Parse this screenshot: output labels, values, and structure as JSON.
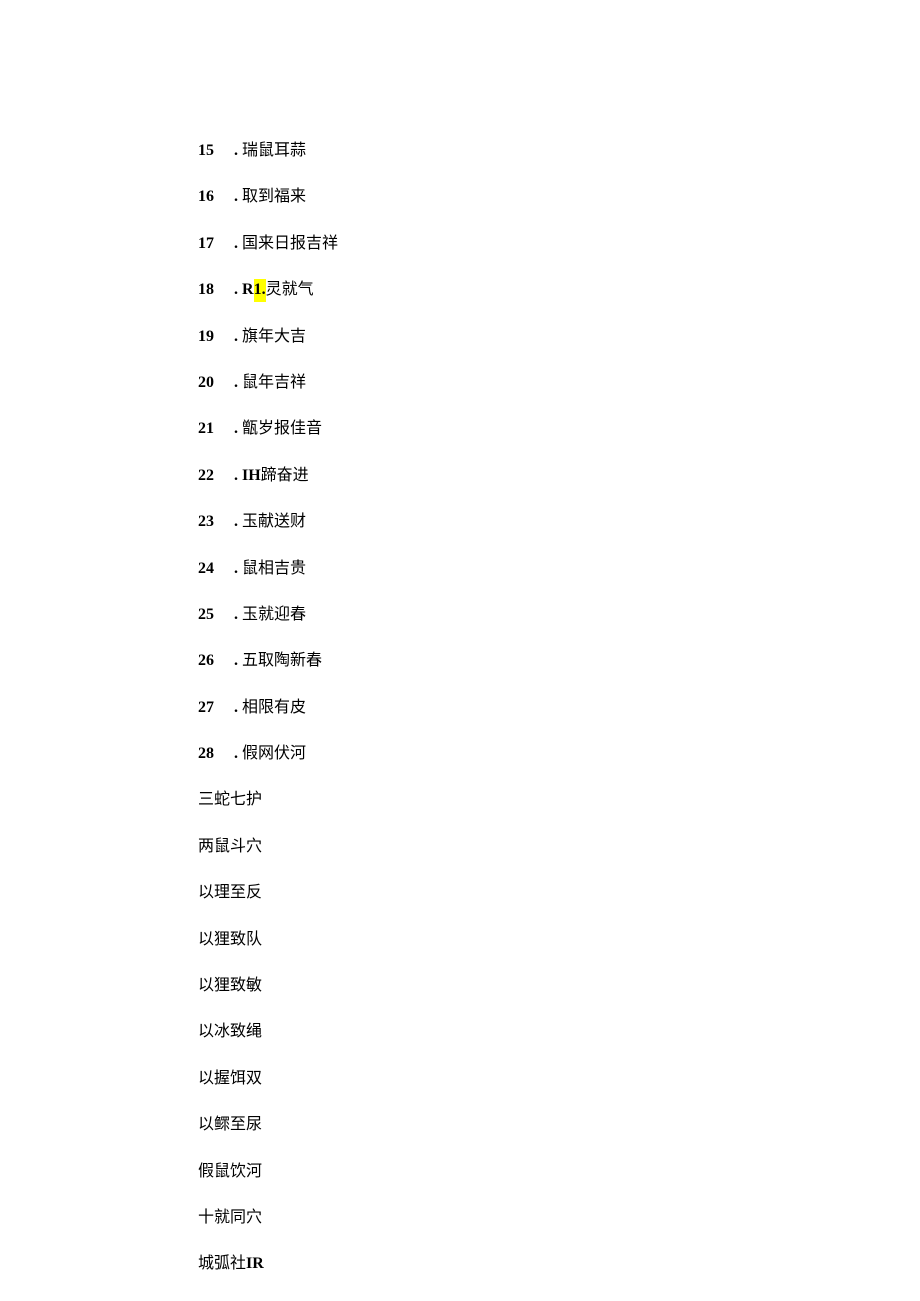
{
  "numbered_items": [
    {
      "num": "15",
      "sep": ".",
      "wide": true,
      "prefix": "",
      "highlight": "",
      "text": "瑞鼠耳蒜"
    },
    {
      "num": "16",
      "sep": ". ",
      "wide": true,
      "prefix": "",
      "highlight": "",
      "text": "取到福来"
    },
    {
      "num": "17",
      "sep": ".",
      "wide": true,
      "prefix": "",
      "highlight": "",
      "text": "国来日报吉祥"
    },
    {
      "num": "18",
      "sep": ".",
      "wide": true,
      "prefix": "R",
      "highlight": "1.",
      "text": "灵就气"
    },
    {
      "num": "19",
      "sep": ".",
      "wide": true,
      "prefix": "",
      "highlight": "",
      "text": "旗年大吉"
    },
    {
      "num": "20",
      "sep": ". ",
      "wide": true,
      "prefix": "",
      "highlight": "",
      "text": "鼠年吉祥"
    },
    {
      "num": "21",
      "sep": ".",
      "wide": true,
      "prefix": "",
      "highlight": "",
      "text": "甑岁报佳音"
    },
    {
      "num": "22",
      "sep": ".",
      "wide": true,
      "prefix": "IH",
      "highlight": "",
      "text": "蹄奋进"
    },
    {
      "num": "23",
      "sep": ". ",
      "wide": true,
      "prefix": "",
      "highlight": "",
      "text": "玉献送财"
    },
    {
      "num": "24",
      "sep": ".",
      "wide": true,
      "prefix": "",
      "highlight": "",
      "text": "鼠相吉贵"
    },
    {
      "num": "25",
      "sep": ". ",
      "wide": true,
      "prefix": "",
      "highlight": "",
      "text": "玉就迎春"
    },
    {
      "num": "26",
      "sep": ".",
      "wide": true,
      "prefix": "",
      "highlight": "",
      "text": "五取陶新春"
    },
    {
      "num": "27",
      "sep": ".",
      "wide": true,
      "prefix": "",
      "highlight": "",
      "text": "相限有皮"
    },
    {
      "num": "28",
      "sep": ". ",
      "wide": true,
      "prefix": "",
      "highlight": "",
      "text": "假网伏河"
    }
  ],
  "plain_items": [
    "三蛇七护",
    "两鼠斗穴",
    "以理至反",
    "以狸致队",
    "以狸致敏",
    "以冰致绳",
    "以握饵双",
    "以鳏至尿",
    "假鼠饮河",
    "十就同穴"
  ],
  "last_line": {
    "text_before": "城弧社",
    "bold_suffix": "IR"
  }
}
